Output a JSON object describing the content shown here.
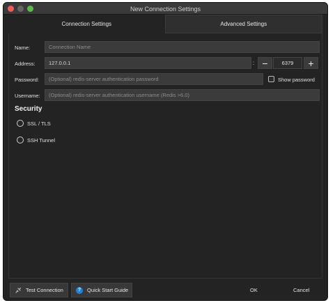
{
  "window": {
    "title": "New Connection Settings"
  },
  "tabs": [
    {
      "label": "Connection Settings"
    },
    {
      "label": "Advanced Settings"
    }
  ],
  "form": {
    "name": {
      "label": "Name:",
      "placeholder": "Connection Name"
    },
    "address": {
      "label": "Address:",
      "value": "127.0.0.1",
      "separator": ":",
      "port": "6379",
      "minus": "−",
      "plus": "+"
    },
    "password": {
      "label": "Password:",
      "placeholder": "(Optional) redis-server authentication password",
      "show_label": "Show password"
    },
    "username": {
      "label": "Username:",
      "placeholder": "(Optional) redis-server authentication username (Redis >6.0)"
    }
  },
  "security": {
    "title": "Security",
    "options": [
      {
        "label": "SSL / TLS"
      },
      {
        "label": "SSH Tunnel"
      }
    ]
  },
  "footer": {
    "test_connection": "Test Connection",
    "quick_start": "Quick Start Guide",
    "help_glyph": "?",
    "ok": "OK",
    "cancel": "Cancel"
  }
}
